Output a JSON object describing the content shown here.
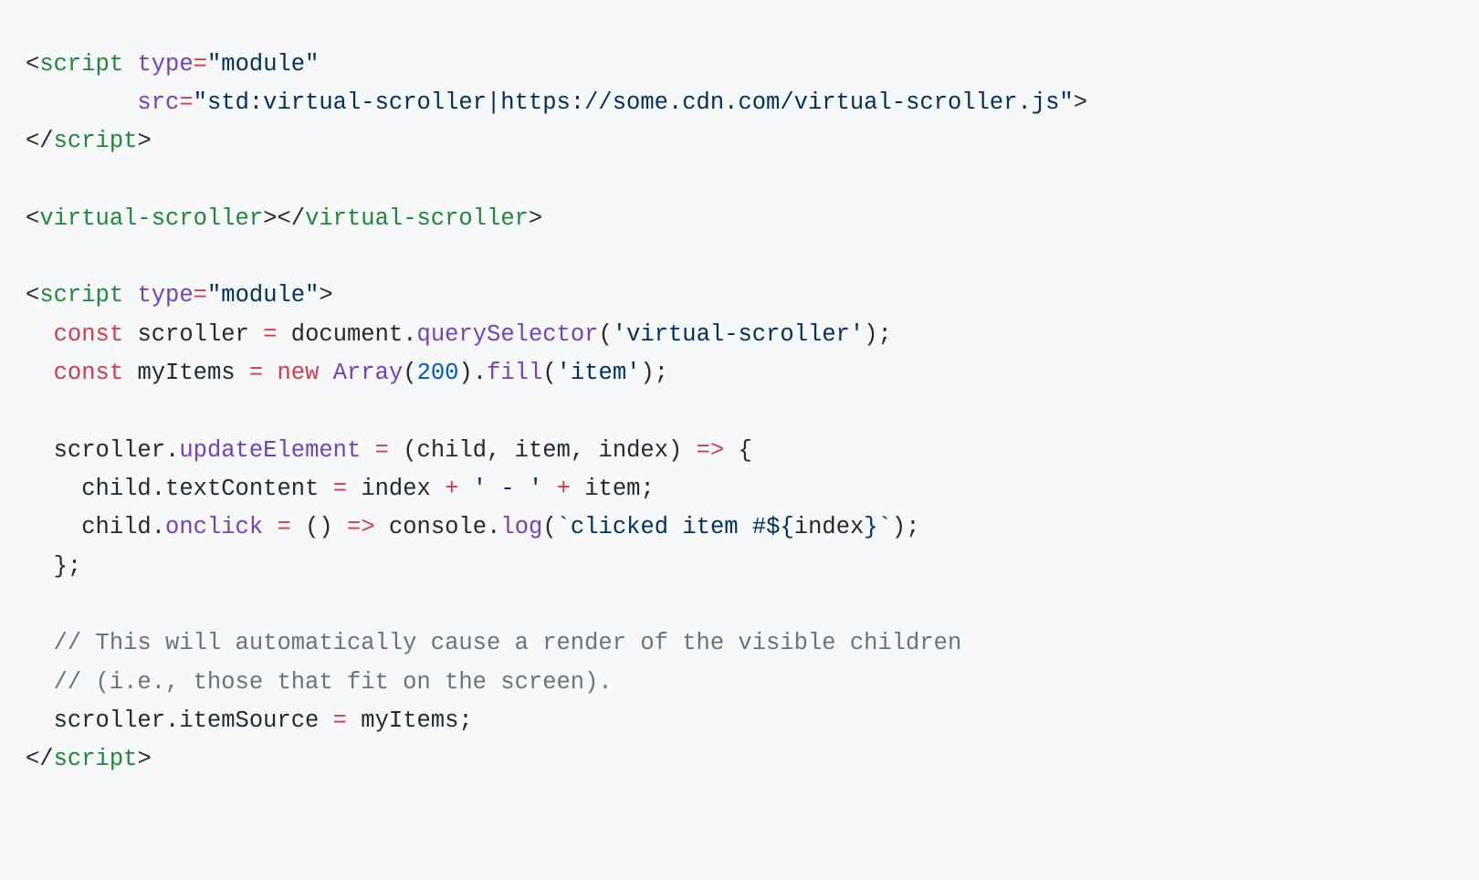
{
  "code": {
    "line1": {
      "tag_open": "script",
      "attr_type": "type",
      "val_type": "\"module\""
    },
    "line2": {
      "attr_src": "src",
      "val_src": "\"std:virtual-scroller|https://some.cdn.com/virtual-scroller.js\""
    },
    "line3": {
      "tag_close": "script"
    },
    "line5": {
      "tag": "virtual-scroller"
    },
    "line7": {
      "tag_open": "script",
      "attr_type": "type",
      "val_type": "\"module\""
    },
    "line8": {
      "kw_const": "const",
      "var_scroller": "scroller",
      "obj_document": "document",
      "fn_query": "querySelector",
      "str_arg": "'virtual-scroller'"
    },
    "line9": {
      "kw_const": "const",
      "var_myItems": "myItems",
      "kw_new": "new",
      "cls_array": "Array",
      "num_200": "200",
      "fn_fill": "fill",
      "str_item": "'item'"
    },
    "line11": {
      "obj_scroller": "scroller",
      "fn_update": "updateElement",
      "param_child": "child",
      "param_item": "item",
      "param_index": "index"
    },
    "line12": {
      "lhs": "child.textContent",
      "rhs_index": "index",
      "str_sep": "' - '",
      "rhs_item": "item"
    },
    "line13": {
      "obj_child": "child",
      "fn_onclick": "onclick",
      "obj_console": "console",
      "fn_log": "log",
      "tmpl_pre": "`clicked item #",
      "interp_open": "${",
      "interp_var": "index",
      "interp_close": "}",
      "tmpl_post": "`"
    },
    "line16": {
      "comment": "// This will automatically cause a render of the visible children"
    },
    "line17": {
      "comment": "// (i.e., those that fit on the screen)."
    },
    "line18": {
      "lhs": "scroller.itemSource",
      "rhs": "myItems"
    },
    "line19": {
      "tag_close": "script"
    }
  }
}
